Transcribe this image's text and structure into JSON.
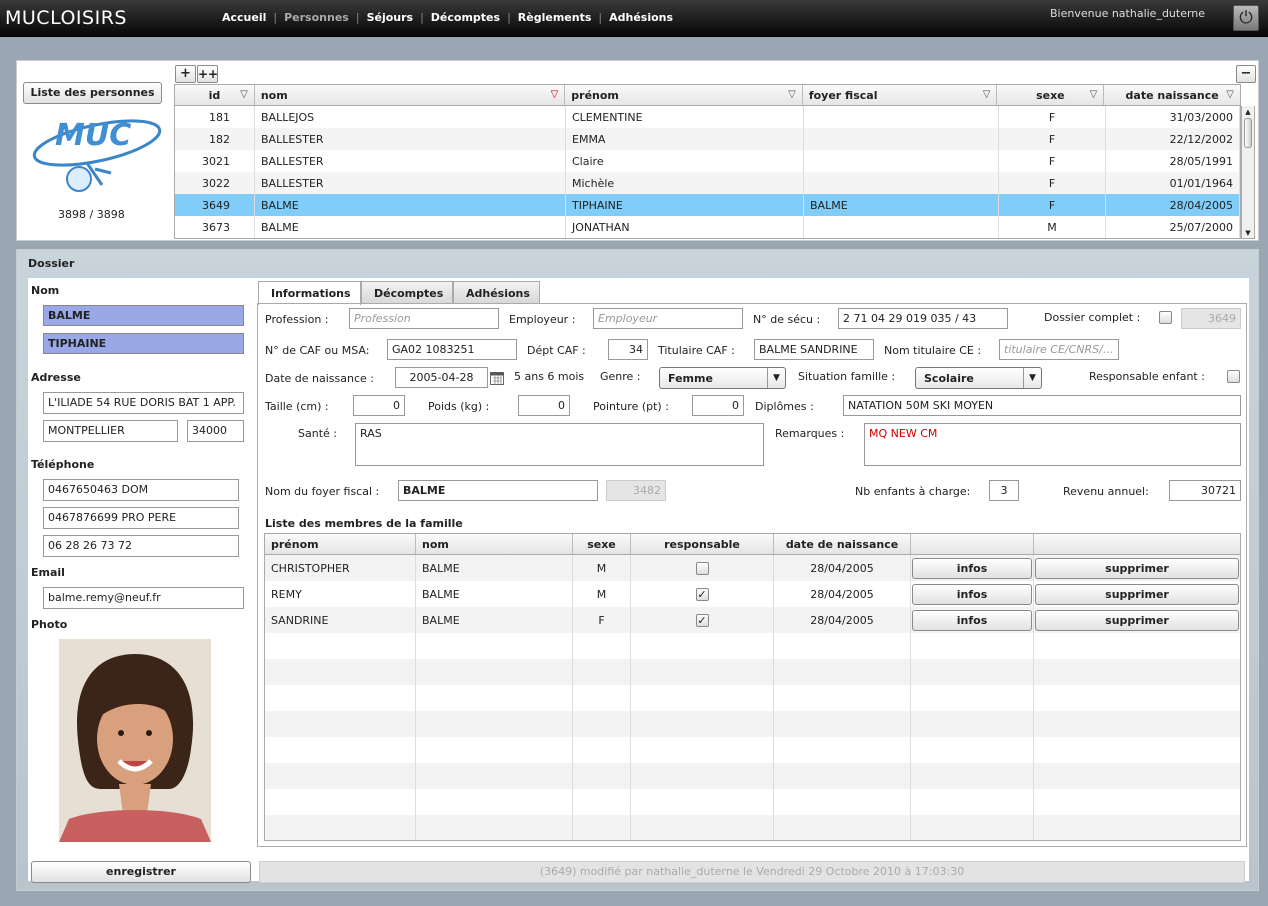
{
  "app": {
    "logo": "MUCLOISIRS",
    "welcome": "Bienvenue nathalie_duterne"
  },
  "nav": [
    {
      "label": "Accueil",
      "active": false
    },
    {
      "label": "Personnes",
      "active": true
    },
    {
      "label": "Séjours",
      "active": false
    },
    {
      "label": "Décomptes",
      "active": false
    },
    {
      "label": "Règlements",
      "active": false
    },
    {
      "label": "Adhésions",
      "active": false
    }
  ],
  "list": {
    "button": "Liste des personnes",
    "logo_text": "MUC",
    "count": "3898 / 3898",
    "add": "+",
    "add_multi": "++",
    "collapse": "−",
    "columns": [
      "id",
      "nom",
      "prénom",
      "foyer fiscal",
      "sexe",
      "date naissance"
    ],
    "rows": [
      [
        "181",
        "BALLEJOS",
        "CLEMENTINE",
        "",
        "F",
        "31/03/2000"
      ],
      [
        "182",
        "BALLESTER",
        "EMMA",
        "",
        "F",
        "22/12/2002"
      ],
      [
        "3021",
        "BALLESTER",
        "Claire",
        "",
        "F",
        "28/05/1991"
      ],
      [
        "3022",
        "BALLESTER",
        "Michèle",
        "",
        "F",
        "01/01/1964"
      ],
      [
        "3649",
        "BALME",
        "TIPHAINE",
        "BALME",
        "F",
        "28/04/2005"
      ],
      [
        "3673",
        "BALME",
        "JONATHAN",
        "",
        "M",
        "25/07/2000"
      ]
    ]
  },
  "dossier": {
    "title": "Dossier",
    "nom_label": "Nom",
    "nom": "BALME",
    "prenom": "TIPHAINE",
    "adresse_label": "Adresse",
    "adresse": "L'ILIADE 54 RUE DORIS BAT 1 APP.",
    "ville": "MONTPELLIER",
    "cp": "34000",
    "telephone_label": "Téléphone",
    "tel1": "0467650463 DOM",
    "tel2": "0467876699 PRO PERE",
    "tel3": "06 28 26 73 72",
    "email_label": "Email",
    "email": "balme.remy@neuf.fr",
    "photo_label": "Photo",
    "save": "enregistrer"
  },
  "tabs": [
    "Informations",
    "Décomptes",
    "Adhésions"
  ],
  "info": {
    "profession_label": "Profession :",
    "profession_ph": "Profession",
    "employeur_label": "Employeur :",
    "employeur_ph": "Employeur",
    "secu_label": "N° de sécu :",
    "secu": "2 71 04 29 019 035 / 43",
    "dossier_complet_label": "Dossier complet :",
    "dossier_id": "3649",
    "caf_label": "N° de CAF ou MSA:",
    "caf": "GA02 1083251",
    "dept_label": "Dépt CAF :",
    "dept": "34",
    "titulaire_label": "Titulaire CAF :",
    "titulaire": "BALME SANDRINE",
    "nom_ce_label": "Nom titulaire CE :",
    "nom_ce_ph": "titulaire CE/CNRS/...",
    "dob_label": "Date de naissance :",
    "dob": "2005-04-28",
    "age": "5 ans 6 mois",
    "genre_label": "Genre :",
    "genre": "Femme",
    "situation_label": "Situation famille :",
    "situation": "Scolaire",
    "resp_enfant_label": "Responsable enfant :",
    "taille_label": "Taille (cm) :",
    "taille": "0",
    "poids_label": "Poids (kg) :",
    "poids": "0",
    "pointure_label": "Pointure (pt) :",
    "pointure": "0",
    "diplomes_label": "Diplômes :",
    "diplomes": "NATATION 50M SKI MOYEN",
    "sante_label": "Santé :",
    "sante": "RAS",
    "remarques_label": "Remarques :",
    "remarques": "MQ NEW CM",
    "foyer_label": "Nom du foyer fiscal :",
    "foyer": "BALME",
    "foyer_id": "3482",
    "nb_enfants_label": "Nb enfants à charge:",
    "nb_enfants": "3",
    "revenu_label": "Revenu annuel:",
    "revenu": "30721"
  },
  "famille": {
    "title": "Liste des membres de la famille",
    "columns": [
      "prénom",
      "nom",
      "sexe",
      "responsable",
      "date de naissance",
      "",
      ""
    ],
    "rows": [
      {
        "prenom": "CHRISTOPHER",
        "nom": "BALME",
        "sexe": "M",
        "responsable": false,
        "dob": "28/04/2005",
        "infos": "infos",
        "supprimer": "supprimer"
      },
      {
        "prenom": "REMY",
        "nom": "BALME",
        "sexe": "M",
        "responsable": true,
        "dob": "28/04/2005",
        "infos": "infos",
        "supprimer": "supprimer"
      },
      {
        "prenom": "SANDRINE",
        "nom": "BALME",
        "sexe": "F",
        "responsable": true,
        "dob": "28/04/2005",
        "infos": "infos",
        "supprimer": "supprimer"
      }
    ]
  },
  "status": "(3649) modifié par nathalie_duterne le Vendredi 29 Octobre 2010 à 17:03:30"
}
